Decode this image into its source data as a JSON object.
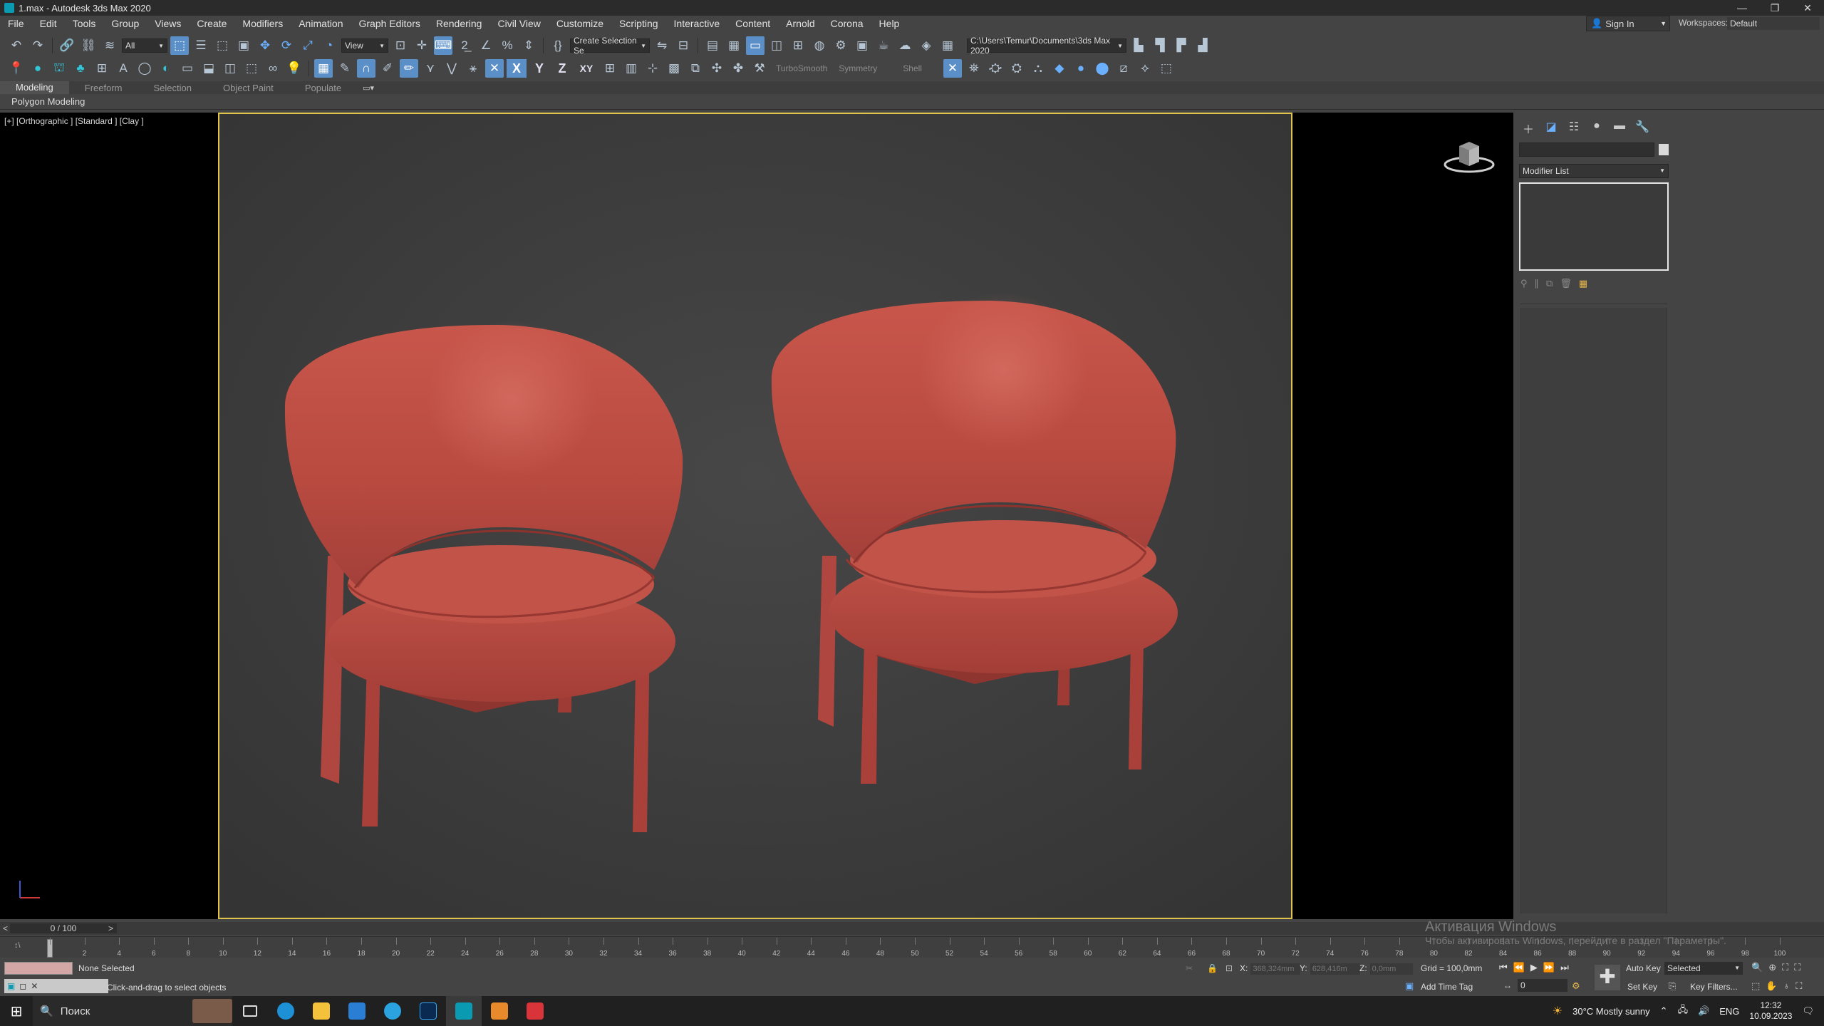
{
  "window": {
    "title": "1.max - Autodesk 3ds Max 2020",
    "min": "—",
    "restore": "❐",
    "close": "✕"
  },
  "menu": [
    "File",
    "Edit",
    "Tools",
    "Group",
    "Views",
    "Create",
    "Modifiers",
    "Animation",
    "Graph Editors",
    "Rendering",
    "Civil View",
    "Customize",
    "Scripting",
    "Interactive",
    "Content",
    "Arnold",
    "Corona",
    "Help"
  ],
  "account": {
    "signin": "Sign In",
    "workspaces_label": "Workspaces:",
    "workspace": "Default"
  },
  "toolbar1": {
    "filter": "All",
    "refcoord": "View",
    "selset": "Create Selection Se",
    "path": "C:\\Users\\Temur\\Documents\\3ds Max 2020"
  },
  "toolbar2": {
    "turbosmooth": "TurboSmooth",
    "symmetry": "Symmetry",
    "shell": "Shell",
    "x": "X",
    "y": "Y",
    "z": "Z",
    "xy": "XY"
  },
  "ribbon": {
    "tabs": [
      "Modeling",
      "Freeform",
      "Selection",
      "Object Paint",
      "Populate"
    ],
    "panel": "Polygon Modeling"
  },
  "viewport": {
    "label": "[+] [Orthographic ] [Standard ] [Clay ]"
  },
  "command_panel": {
    "modifier_list": "Modifier List"
  },
  "timeline": {
    "frame": "0 / 100",
    "ticks": [
      0,
      2,
      4,
      6,
      8,
      10,
      12,
      14,
      16,
      18,
      20,
      22,
      24,
      26,
      28,
      30,
      32,
      34,
      36,
      38,
      40,
      42,
      44,
      46,
      48,
      50,
      52,
      54,
      56,
      58,
      60,
      62,
      64,
      66,
      68,
      70,
      72,
      74,
      76,
      78,
      80,
      82,
      84,
      86,
      88,
      90,
      92,
      94,
      96,
      98,
      100
    ]
  },
  "activation": {
    "title": "Активация Windows",
    "text": "Чтобы активировать Windows, перейдите в раздел \"Параметры\"."
  },
  "status": {
    "selection": "None Selected",
    "prompt": "Click-and-drag to select objects",
    "x_label": "X:",
    "x_val": "368,324mm",
    "y_label": "Y:",
    "y_val": "628,416m",
    "z_label": "Z:",
    "z_val": "0,0mm",
    "grid": "Grid = 100,0mm",
    "add_time_tag": "Add Time Tag",
    "auto_key": "Auto Key",
    "selected": "Selected",
    "set_key": "Set Key",
    "key_filters": "Key Filters...",
    "frame_field": "0"
  },
  "taskbar": {
    "search": "Поиск",
    "weather": "30°C  Mostly sunny",
    "lang": "ENG",
    "time": "12:32",
    "date": "10.09.2023"
  }
}
